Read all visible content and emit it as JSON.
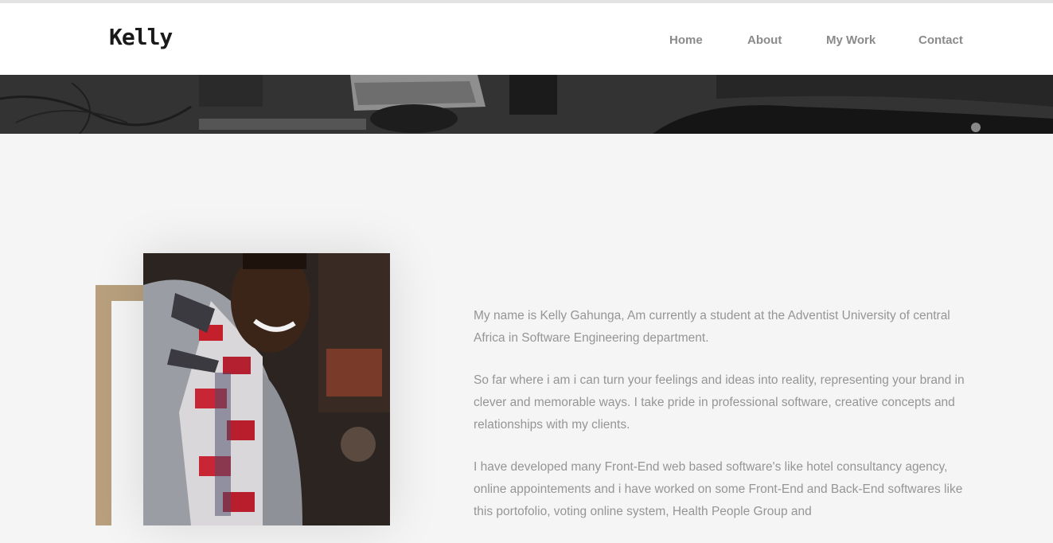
{
  "brand": {
    "logo": "Kelly"
  },
  "nav": {
    "items": [
      {
        "label": "Home"
      },
      {
        "label": "About"
      },
      {
        "label": "My Work"
      },
      {
        "label": "Contact"
      }
    ]
  },
  "about": {
    "paragraphs": [
      "My name is Kelly Gahunga, Am currently a student at the Adventist University of central Africa in Software Engineering department.",
      "So far where i am i can turn your feelings and ideas into reality, representing your brand in clever and memorable ways. I take pride in professional software, creative concepts and relationships with my clients.",
      "I have developed many Front-End web based software's like hotel consultancy agency, online appointements and i have worked on some Front-End and Back-End softwares like this portofolio, voting online system, Health People Group and"
    ]
  },
  "colors": {
    "accent": "#b8a07e",
    "nav_text": "#8a8a8a",
    "body_text": "#959595",
    "background": "#f5f5f5"
  }
}
